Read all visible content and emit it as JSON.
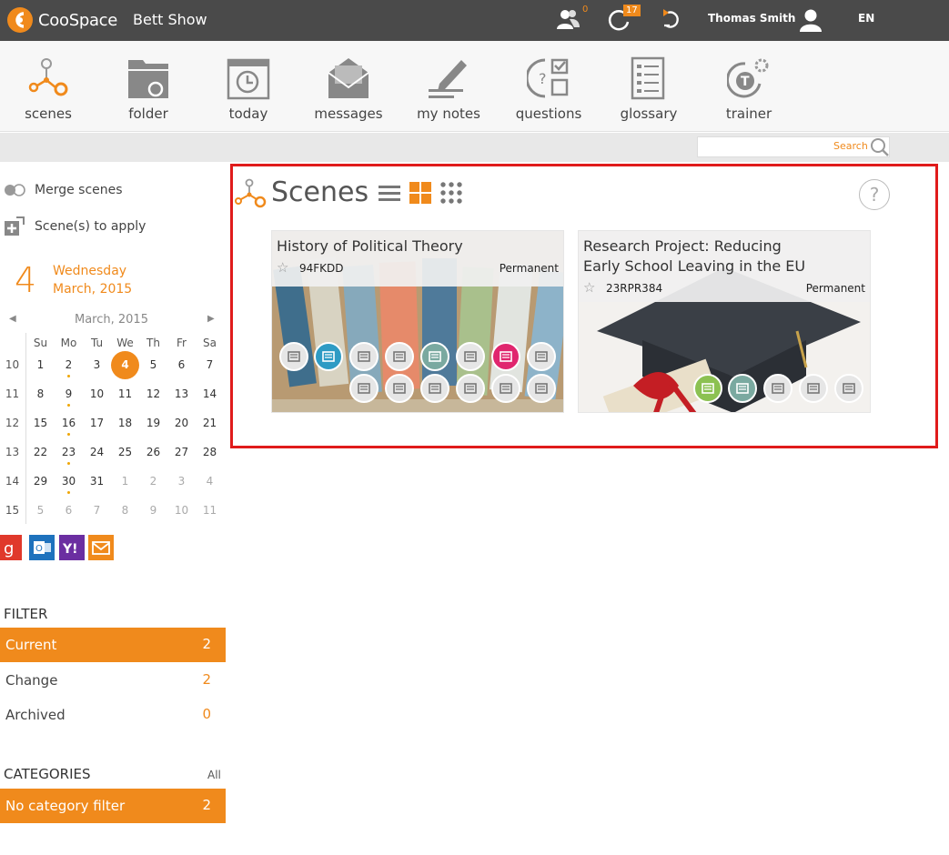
{
  "topbar": {
    "logo_text": "CooSpace",
    "app_title": "Bett Show",
    "users_badge": "0",
    "updates_badge": "17",
    "user_name": "Thomas Smith",
    "language": "EN"
  },
  "toolbar": {
    "items": [
      {
        "label": "scenes",
        "icon": "scenes-icon"
      },
      {
        "label": "folder",
        "icon": "folder-icon"
      },
      {
        "label": "today",
        "icon": "today-icon"
      },
      {
        "label": "messages",
        "icon": "messages-icon"
      },
      {
        "label": "my notes",
        "icon": "notes-icon"
      },
      {
        "label": "questions",
        "icon": "questions-icon"
      },
      {
        "label": "glossary",
        "icon": "glossary-icon"
      },
      {
        "label": "trainer",
        "icon": "trainer-icon"
      }
    ]
  },
  "search": {
    "label": "Search",
    "placeholder": ""
  },
  "sidebar": {
    "merge_label": "Merge scenes",
    "apply_label": "Scene(s) to apply",
    "day_number": "4",
    "weekday": "Wednesday",
    "month_year": "March, 2015",
    "calendar": {
      "title": "March, 2015",
      "days_of_week": [
        "Su",
        "Mo",
        "Tu",
        "We",
        "Th",
        "Fr",
        "Sa"
      ],
      "weeks": [
        {
          "week": "10",
          "days": [
            "1",
            "2",
            "3",
            "4",
            "5",
            "6",
            "7"
          ]
        },
        {
          "week": "11",
          "days": [
            "8",
            "9",
            "10",
            "11",
            "12",
            "13",
            "14"
          ]
        },
        {
          "week": "12",
          "days": [
            "15",
            "16",
            "17",
            "18",
            "19",
            "20",
            "21"
          ]
        },
        {
          "week": "13",
          "days": [
            "22",
            "23",
            "24",
            "25",
            "26",
            "27",
            "28"
          ]
        },
        {
          "week": "14",
          "days": [
            "29",
            "30",
            "31",
            "1",
            "2",
            "3",
            "4"
          ]
        },
        {
          "week": "15",
          "days": [
            "5",
            "6",
            "7",
            "8",
            "9",
            "10",
            "11"
          ]
        }
      ],
      "today": "4"
    },
    "filter": {
      "title": "FILTER",
      "items": [
        {
          "label": "Current",
          "count": "2"
        },
        {
          "label": "Change",
          "count": "2"
        },
        {
          "label": "Archived",
          "count": "0"
        }
      ]
    },
    "categories": {
      "title": "CATEGORIES",
      "all_label": "All",
      "items": [
        {
          "label": "No category filter",
          "count": "2"
        }
      ]
    }
  },
  "main": {
    "title": "Scenes",
    "help": "?",
    "cards": [
      {
        "title": "History of Political Theory",
        "code": "94FKDD",
        "status": "Permanent"
      },
      {
        "title_line1": "Research Project: Reducing",
        "title_line2": "Early School Leaving in the EU",
        "code": "23RPR384",
        "status": "Permanent"
      }
    ]
  },
  "colors": {
    "accent": "#f08a1c",
    "topbar": "#4a4a4a",
    "highlight": "#e01b1b"
  }
}
